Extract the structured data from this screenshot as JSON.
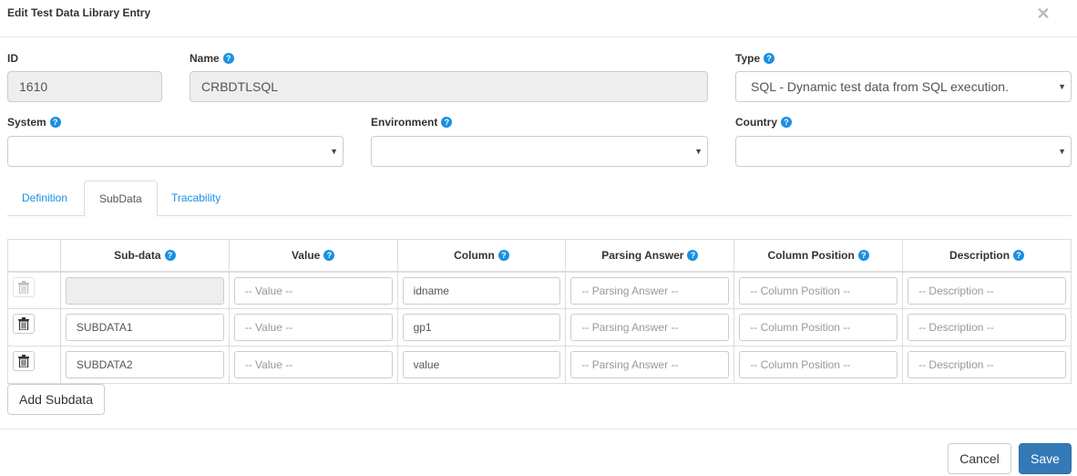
{
  "modal": {
    "title": "Edit Test Data Library Entry",
    "close_icon": "close-icon"
  },
  "form": {
    "id": {
      "label": "ID",
      "value": "1610"
    },
    "name": {
      "label": "Name",
      "value": "CRBDTLSQL"
    },
    "type": {
      "label": "Type",
      "value": "SQL - Dynamic test data from SQL execution."
    },
    "system": {
      "label": "System",
      "value": ""
    },
    "environment": {
      "label": "Environment",
      "value": ""
    },
    "country": {
      "label": "Country",
      "value": ""
    },
    "help_icon": "?"
  },
  "tabs": [
    {
      "label": "Definition",
      "active": false
    },
    {
      "label": "SubData",
      "active": true
    },
    {
      "label": "Tracability",
      "active": false
    }
  ],
  "subdata_table": {
    "headers": [
      "",
      "Sub-data",
      "Value",
      "Column",
      "Parsing Answer",
      "Column Position",
      "Description"
    ],
    "placeholders": {
      "value": "-- Value --",
      "parsing_answer": "-- Parsing Answer --",
      "column_position": "-- Column Position --",
      "description": "-- Description --"
    },
    "rows": [
      {
        "subdata": "",
        "subdata_readonly": true,
        "delete_disabled": true,
        "value": "",
        "column": "idname",
        "parsing_answer": "",
        "column_position": "",
        "description": ""
      },
      {
        "subdata": "SUBDATA1",
        "subdata_readonly": false,
        "delete_disabled": false,
        "value": "",
        "column": "gp1",
        "parsing_answer": "",
        "column_position": "",
        "description": ""
      },
      {
        "subdata": "SUBDATA2",
        "subdata_readonly": false,
        "delete_disabled": false,
        "value": "",
        "column": "value",
        "parsing_answer": "",
        "column_position": "",
        "description": ""
      }
    ],
    "add_button": "Add Subdata"
  },
  "footer": {
    "cancel": "Cancel",
    "save": "Save"
  },
  "colors": {
    "accent": "#1a8fe3",
    "primary_button": "#337ab7"
  }
}
